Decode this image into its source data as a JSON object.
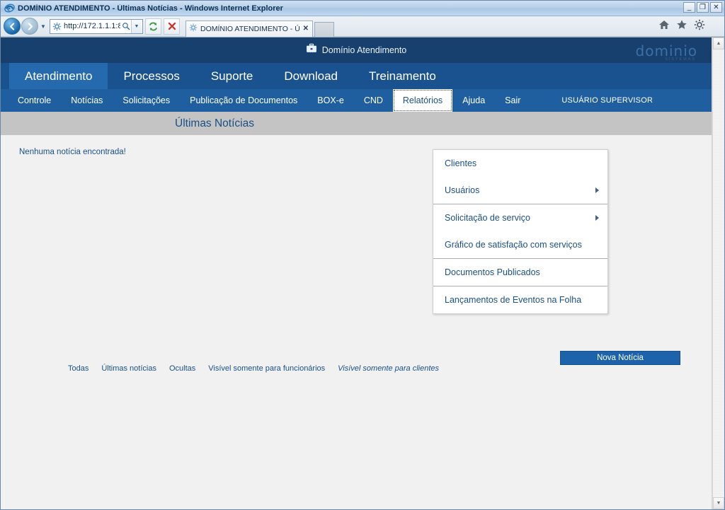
{
  "browser": {
    "window_title": "DOMÍNIO ATENDIMENTO - Últimas Notícias - Windows Internet Explorer",
    "url": "http://172.1.1.1:8",
    "tab_title": "DOMÍNIO ATENDIMENTO - Ú...",
    "tab_close_label": "✕",
    "window_controls": {
      "minimize": "_",
      "maximize": "❐",
      "close": "✕"
    },
    "toolbar_icons": [
      "back-icon",
      "forward-icon",
      "refresh-icon",
      "stop-icon",
      "home-icon",
      "favorites-icon",
      "tools-icon"
    ]
  },
  "site": {
    "brand": "Domínio Atendimento",
    "logo": "dominio",
    "logo_sub": "SISTEMAS"
  },
  "mainnav": [
    {
      "label": "Atendimento",
      "active": true
    },
    {
      "label": "Processos",
      "active": false
    },
    {
      "label": "Suporte",
      "active": false
    },
    {
      "label": "Download",
      "active": false
    },
    {
      "label": "Treinamento",
      "active": false
    }
  ],
  "subnav": {
    "items": [
      {
        "label": "Controle",
        "active": false
      },
      {
        "label": "Notícias",
        "active": false
      },
      {
        "label": "Solicitações",
        "active": false
      },
      {
        "label": "Publicação de Documentos",
        "active": false
      },
      {
        "label": "BOX-e",
        "active": false
      },
      {
        "label": "CND",
        "active": false
      },
      {
        "label": "Relatórios",
        "active": true
      },
      {
        "label": "Ajuda",
        "active": false
      },
      {
        "label": "Sair",
        "active": false
      }
    ],
    "user": "USUÁRIO SUPERVISOR"
  },
  "dropdown": {
    "owner": "Relatórios",
    "groups": [
      {
        "items": [
          {
            "label": "Clientes",
            "has_submenu": false
          },
          {
            "label": "Usuários",
            "has_submenu": true
          }
        ]
      },
      {
        "items": [
          {
            "label": "Solicitação de serviço",
            "has_submenu": true
          },
          {
            "label": "Gráfico de satisfação com serviços",
            "has_submenu": false
          }
        ]
      },
      {
        "items": [
          {
            "label": "Documentos Publicados",
            "has_submenu": false
          }
        ]
      },
      {
        "items": [
          {
            "label": "Lançamentos de Eventos na Folha",
            "has_submenu": false
          }
        ]
      }
    ]
  },
  "page": {
    "title": "Últimas Notícias",
    "empty_message": "Nenhuma notícia encontrada!",
    "new_button": "Nova Notícia",
    "filters": [
      {
        "label": "Todas",
        "current": false
      },
      {
        "label": "Últimas notícias",
        "current": false
      },
      {
        "label": "Ocultas",
        "current": false
      },
      {
        "label": "Visível somente para funcionários",
        "current": false
      },
      {
        "label": "Visível somente para clientes",
        "current": true
      }
    ]
  },
  "colors": {
    "header_dark": "#17406f",
    "nav_blue": "#1a528f",
    "subnav_blue": "#1f5fa0",
    "accent": "#1d63ab",
    "link": "#1b4f85",
    "titlebar_gray": "#c4c4c4",
    "page_bg": "#f1f1f1"
  },
  "scrollbar": {
    "up": "▲",
    "down": "▼"
  }
}
